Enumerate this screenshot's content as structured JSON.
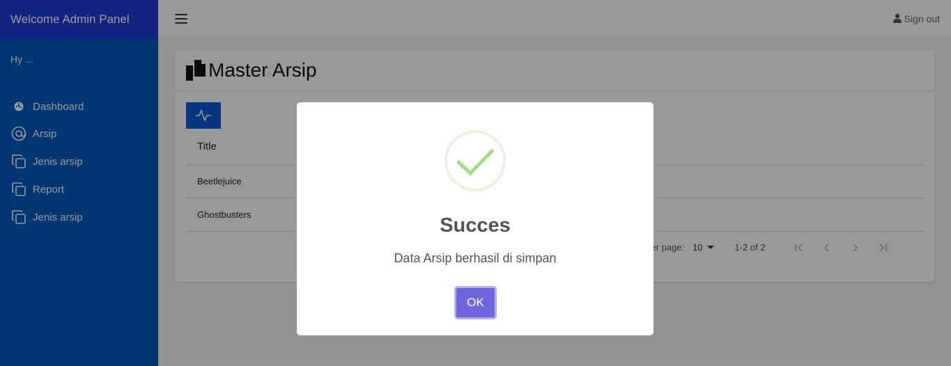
{
  "sidebar": {
    "header": "Welcome Admin Panel",
    "greeting": "Hy ...",
    "items": [
      {
        "label": "Dashboard",
        "icon": "dashboard-icon"
      },
      {
        "label": "Arsip",
        "icon": "at-icon"
      },
      {
        "label": "Jenis arsip",
        "icon": "copy-icon"
      },
      {
        "label": "Report",
        "icon": "copy-icon"
      },
      {
        "label": "Jenis arsip",
        "icon": "copy-icon"
      }
    ]
  },
  "topbar": {
    "signout_label": "Sign out"
  },
  "page": {
    "title": "Master Arsip"
  },
  "table": {
    "header": "Title",
    "rows": [
      "Beetlejuice",
      "Ghostbusters"
    ]
  },
  "pagination": {
    "rows_per_page_label": "Rows per page:",
    "rows_per_page_value": "10",
    "range": "1-2 of 2"
  },
  "modal": {
    "title": "Succes",
    "message": "Data Arsip berhasil di simpan",
    "ok_label": "OK"
  },
  "colors": {
    "sidebar_bg": "#005cbf",
    "sidebar_header_bg": "#1d3fd6",
    "action_btn": "#0a5ad6",
    "ok_btn": "#7066e0",
    "success": "#a5dc86"
  }
}
